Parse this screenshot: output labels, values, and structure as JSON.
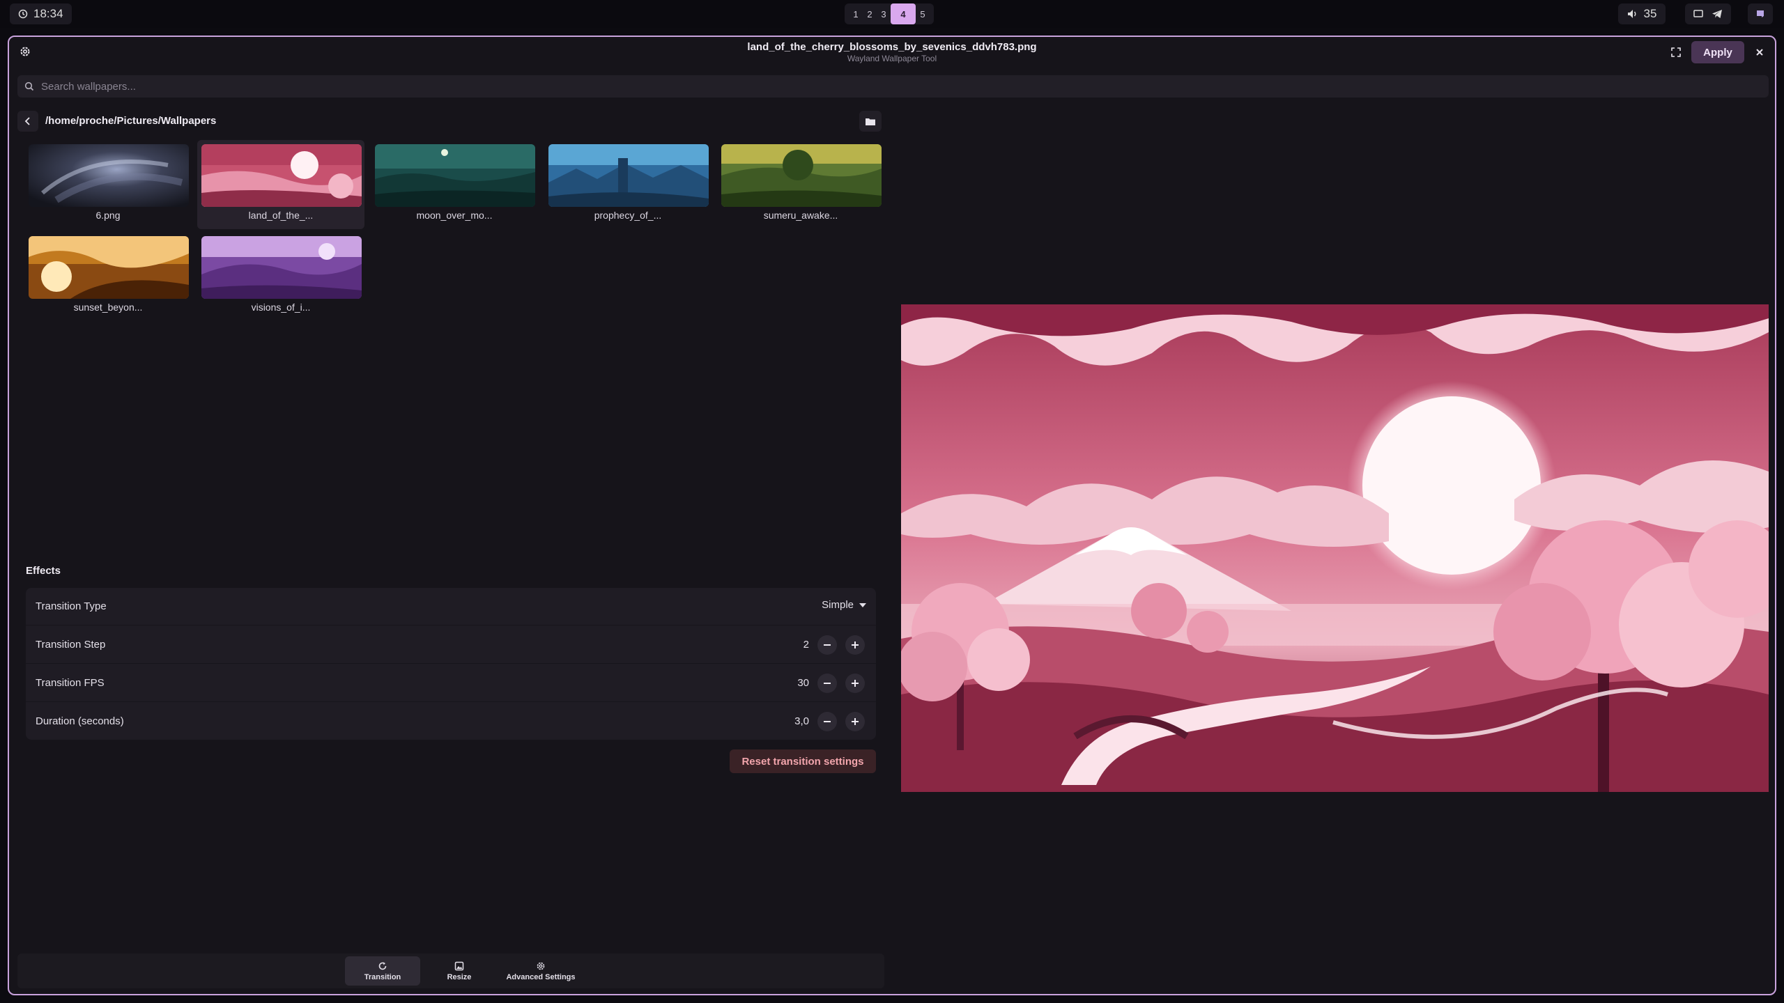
{
  "topbar": {
    "clock": "18:34",
    "workspaces": [
      "1",
      "2",
      "3",
      "4",
      "5"
    ],
    "active_workspace": "4",
    "volume": "35"
  },
  "window": {
    "title": "land_of_the_cherry_blossoms_by_sevenics_ddvh783.png",
    "subtitle": "Wayland Wallpaper Tool",
    "apply_label": "Apply"
  },
  "search": {
    "placeholder": "Search wallpapers..."
  },
  "browser": {
    "path": "/home/proche/Pictures/Wallpapers",
    "thumbnails": [
      {
        "label": "6.png",
        "selected": false
      },
      {
        "label": "land_of_the_...",
        "selected": true
      },
      {
        "label": "moon_over_mo...",
        "selected": false
      },
      {
        "label": "prophecy_of_...",
        "selected": false
      },
      {
        "label": "sumeru_awake...",
        "selected": false
      },
      {
        "label": "sunset_beyon...",
        "selected": false
      },
      {
        "label": "visions_of_i...",
        "selected": false
      }
    ]
  },
  "effects": {
    "title": "Effects",
    "rows": [
      {
        "label": "Transition Type",
        "value": "Simple"
      },
      {
        "label": "Transition Step",
        "value": "2"
      },
      {
        "label": "Transition FPS",
        "value": "30"
      },
      {
        "label": "Duration (seconds)",
        "value": "3,0"
      }
    ],
    "reset_label": "Reset transition settings"
  },
  "tabs": [
    {
      "label": "Transition",
      "icon": "refresh-icon",
      "active": true
    },
    {
      "label": "Resize",
      "icon": "image-icon",
      "active": false
    },
    {
      "label": "Advanced Settings",
      "icon": "gear-icon",
      "active": false
    }
  ],
  "colors": {
    "accent": "#d9a8ee",
    "window_border": "#c9a3dd",
    "apply_bg": "#4a3555",
    "reset_text": "#f2a5ac"
  }
}
